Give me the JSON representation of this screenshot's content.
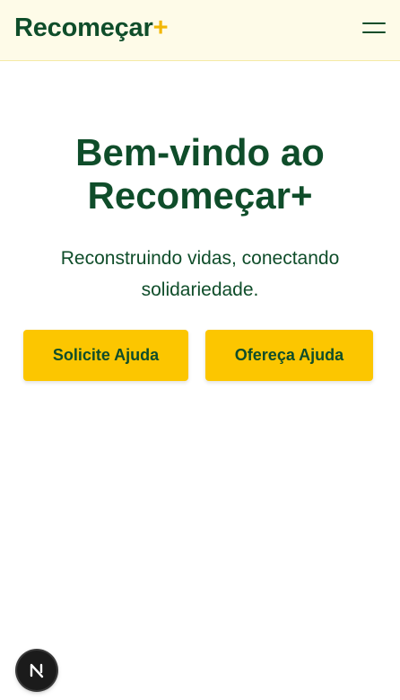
{
  "header": {
    "logo_text": "Recomeçar",
    "logo_plus": "+",
    "menu_icon": "hamburger-menu-icon"
  },
  "hero": {
    "title_line1": "Bem-vindo ao",
    "title_line2": "Recomeçar+",
    "subtitle_line1": "Reconstruindo vidas, conectando",
    "subtitle_line2": "solidariedade."
  },
  "actions": {
    "request_label": "Solicite Ajuda",
    "offer_label": "Ofereça Ajuda"
  },
  "dev_badge": {
    "icon": "nextjs-logo-icon",
    "letter": "N"
  },
  "colors": {
    "brand_green": "#0f4d2a",
    "accent_yellow": "#fcc600",
    "header_bg": "#fefbe8"
  }
}
